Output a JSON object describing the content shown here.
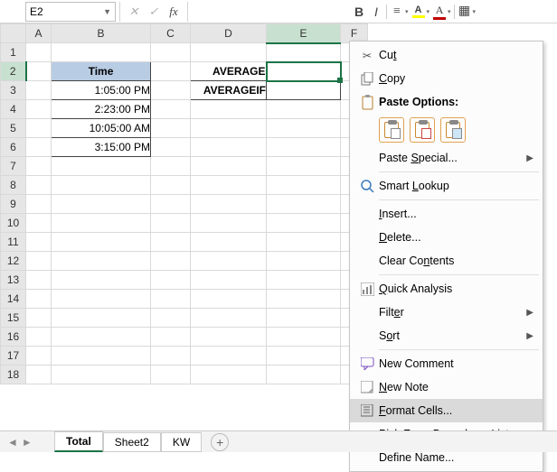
{
  "namebox": {
    "value": "E2"
  },
  "formula_bar": {
    "cancel_glyph": "✕",
    "confirm_glyph": "✓",
    "fx_glyph": "fx",
    "value": ""
  },
  "mini_toolbar": {
    "bold": "B",
    "italic": "I",
    "highlight_color": "#ffff00",
    "font_color": "#c00000"
  },
  "columns": [
    "A",
    "B",
    "C",
    "D",
    "E",
    "F"
  ],
  "rows": [
    1,
    2,
    3,
    4,
    5,
    6,
    7,
    8,
    9,
    10,
    11,
    12,
    13,
    14,
    15,
    16,
    17,
    18
  ],
  "selected_cell": "E2",
  "cells": {
    "B2": "Time",
    "B3": "1:05:00 PM",
    "B4": "2:23:00 PM",
    "B5": "10:05:00 AM",
    "B6": "3:15:00 PM",
    "D2": "AVERAGE",
    "D3": "AVERAGEIF"
  },
  "sheet_tabs": {
    "active": "Total",
    "tabs": [
      "Total",
      "Sheet2",
      "KW"
    ]
  },
  "context_menu": {
    "cut": "Cut",
    "copy": "Copy",
    "paste_options_title": "Paste Options:",
    "paste_special": "Paste Special...",
    "smart_lookup": "Smart Lookup",
    "insert": "Insert...",
    "delete": "Delete...",
    "clear_contents": "Clear Contents",
    "quick_analysis": "Quick Analysis",
    "filter": "Filter",
    "sort": "Sort",
    "new_comment": "New Comment",
    "new_note": "New Note",
    "format_cells": "Format Cells...",
    "pick_from_list": "Pick From Drop-down List...",
    "define_name": "Define Name..."
  }
}
